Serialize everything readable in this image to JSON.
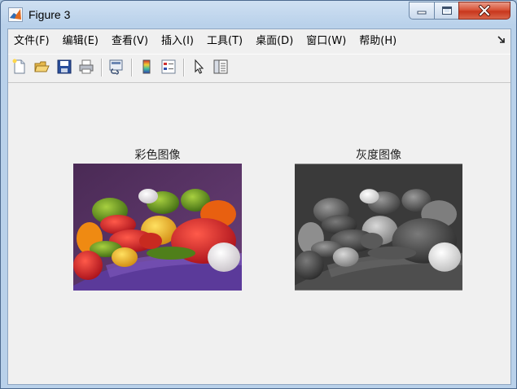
{
  "window": {
    "title": "Figure 3",
    "icon": "matlab-icon",
    "controls": [
      "minimize-icon",
      "maximize-icon",
      "close-icon"
    ]
  },
  "menubar": {
    "items": [
      {
        "label": "文件(F)"
      },
      {
        "label": "编辑(E)"
      },
      {
        "label": "查看(V)"
      },
      {
        "label": "插入(I)"
      },
      {
        "label": "工具(T)"
      },
      {
        "label": "桌面(D)"
      },
      {
        "label": "窗口(W)"
      },
      {
        "label": "帮助(H)"
      }
    ],
    "extra_icon": "dock-arrow-icon"
  },
  "toolbar": {
    "buttons": [
      "new-figure-icon",
      "open-file-icon",
      "save-icon",
      "print-icon",
      "link-plot-icon",
      "colorbar-icon",
      "legend-icon",
      "pointer-icon",
      "property-editor-icon"
    ]
  },
  "figure": {
    "left_title": "彩色图像",
    "right_title": "灰度图像",
    "left_image": "color-peppers-image",
    "right_image": "grayscale-peppers-image"
  },
  "colors": {
    "close_red": "#c8361c",
    "client_bg": "#f0f0f0",
    "frame_blue": "#b9d1ea"
  }
}
